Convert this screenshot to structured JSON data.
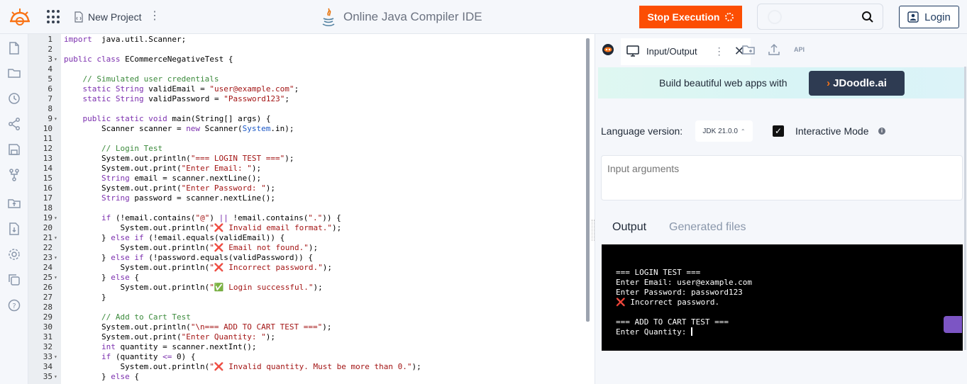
{
  "header": {
    "project_name": "New Project",
    "title": "Online Java Compiler IDE",
    "stop_label": "Stop Execution",
    "login_label": "Login"
  },
  "sidebar": {
    "icons": [
      "file-icon",
      "folder-icon",
      "history-icon",
      "share-icon",
      "save-icon",
      "fork-icon",
      "folder-upload-icon",
      "download-icon",
      "settings-icon",
      "copy-icon",
      "help-icon"
    ]
  },
  "editor": {
    "lines": [
      {
        "n": "1",
        "fold": "",
        "segs": [
          [
            "kw",
            "import"
          ],
          [
            "",
            "  java.util.Scanner;"
          ]
        ]
      },
      {
        "n": "2",
        "fold": "",
        "segs": []
      },
      {
        "n": "3",
        "fold": "▾",
        "segs": [
          [
            "kw",
            "public"
          ],
          [
            "",
            " "
          ],
          [
            "kw",
            "class"
          ],
          [
            "",
            " ECommerceNegativeTest {"
          ]
        ]
      },
      {
        "n": "4",
        "fold": "",
        "segs": []
      },
      {
        "n": "5",
        "fold": "",
        "segs": [
          [
            "",
            "    "
          ],
          [
            "cm",
            "// Simulated user credentials"
          ]
        ]
      },
      {
        "n": "6",
        "fold": "",
        "segs": [
          [
            "",
            "    "
          ],
          [
            "kw",
            "static"
          ],
          [
            "",
            " "
          ],
          [
            "ty",
            "String"
          ],
          [
            "",
            " validEmail = "
          ],
          [
            "str",
            "\"user@example.com\""
          ],
          [
            "",
            ";"
          ]
        ]
      },
      {
        "n": "7",
        "fold": "",
        "segs": [
          [
            "",
            "    "
          ],
          [
            "kw",
            "static"
          ],
          [
            "",
            " "
          ],
          [
            "ty",
            "String"
          ],
          [
            "",
            " validPassword = "
          ],
          [
            "str",
            "\"Password123\""
          ],
          [
            "",
            ";"
          ]
        ]
      },
      {
        "n": "8",
        "fold": "",
        "segs": []
      },
      {
        "n": "9",
        "fold": "▾",
        "segs": [
          [
            "",
            "    "
          ],
          [
            "kw",
            "public"
          ],
          [
            "",
            " "
          ],
          [
            "kw",
            "static"
          ],
          [
            "",
            " "
          ],
          [
            "kw",
            "void"
          ],
          [
            "",
            " main(String[] args) {"
          ]
        ]
      },
      {
        "n": "10",
        "fold": "",
        "segs": [
          [
            "",
            "        Scanner scanner = "
          ],
          [
            "kw",
            "new"
          ],
          [
            "",
            " Scanner("
          ],
          [
            "blue",
            "System"
          ],
          [
            "",
            ".in);"
          ]
        ]
      },
      {
        "n": "11",
        "fold": "",
        "segs": []
      },
      {
        "n": "12",
        "fold": "",
        "segs": [
          [
            "",
            "        "
          ],
          [
            "cm",
            "// Login Test"
          ]
        ]
      },
      {
        "n": "13",
        "fold": "",
        "segs": [
          [
            "",
            "        System.out.println("
          ],
          [
            "str",
            "\"=== LOGIN TEST ===\""
          ],
          [
            "",
            ");"
          ]
        ]
      },
      {
        "n": "14",
        "fold": "",
        "segs": [
          [
            "",
            "        System.out.print("
          ],
          [
            "str",
            "\"Enter Email: \""
          ],
          [
            "",
            ");"
          ]
        ]
      },
      {
        "n": "15",
        "fold": "",
        "segs": [
          [
            "",
            "        "
          ],
          [
            "ty",
            "String"
          ],
          [
            "",
            " email = scanner.nextLine();"
          ]
        ]
      },
      {
        "n": "16",
        "fold": "",
        "segs": [
          [
            "",
            "        System.out.print("
          ],
          [
            "str",
            "\"Enter Password: \""
          ],
          [
            "",
            ");"
          ]
        ]
      },
      {
        "n": "17",
        "fold": "",
        "segs": [
          [
            "",
            "        "
          ],
          [
            "ty",
            "String"
          ],
          [
            "",
            " password = scanner.nextLine();"
          ]
        ]
      },
      {
        "n": "18",
        "fold": "",
        "segs": []
      },
      {
        "n": "19",
        "fold": "▾",
        "segs": [
          [
            "",
            "        "
          ],
          [
            "kw",
            "if"
          ],
          [
            "",
            " (!email.contains("
          ],
          [
            "str",
            "\"@\""
          ],
          [
            "",
            ") "
          ],
          [
            "op",
            "||"
          ],
          [
            "",
            " !email.contains("
          ],
          [
            "str",
            "\".\""
          ],
          [
            "",
            ")) {"
          ]
        ]
      },
      {
        "n": "20",
        "fold": "",
        "segs": [
          [
            "",
            "            System.out.println("
          ],
          [
            "str",
            "\"❌ Invalid email format.\""
          ],
          [
            "",
            ");"
          ]
        ]
      },
      {
        "n": "21",
        "fold": "▾",
        "segs": [
          [
            "",
            "        } "
          ],
          [
            "kw",
            "else"
          ],
          [
            "",
            " "
          ],
          [
            "kw",
            "if"
          ],
          [
            "",
            " (!email.equals(validEmail)) {"
          ]
        ]
      },
      {
        "n": "22",
        "fold": "",
        "segs": [
          [
            "",
            "            System.out.println("
          ],
          [
            "str",
            "\"❌ Email not found.\""
          ],
          [
            "",
            ");"
          ]
        ]
      },
      {
        "n": "23",
        "fold": "▾",
        "segs": [
          [
            "",
            "        } "
          ],
          [
            "kw",
            "else"
          ],
          [
            "",
            " "
          ],
          [
            "kw",
            "if"
          ],
          [
            "",
            " (!password.equals(validPassword)) {"
          ]
        ]
      },
      {
        "n": "24",
        "fold": "",
        "segs": [
          [
            "",
            "            System.out.println("
          ],
          [
            "str",
            "\"❌ Incorrect password.\""
          ],
          [
            "",
            ");"
          ]
        ]
      },
      {
        "n": "25",
        "fold": "▾",
        "segs": [
          [
            "",
            "        } "
          ],
          [
            "kw",
            "else"
          ],
          [
            "",
            " {"
          ]
        ]
      },
      {
        "n": "26",
        "fold": "",
        "segs": [
          [
            "",
            "            System.out.println("
          ],
          [
            "str",
            "\"✅ Login successful.\""
          ],
          [
            "",
            ");"
          ]
        ]
      },
      {
        "n": "27",
        "fold": "",
        "segs": [
          [
            "",
            "        }"
          ]
        ]
      },
      {
        "n": "28",
        "fold": "",
        "segs": []
      },
      {
        "n": "29",
        "fold": "",
        "segs": [
          [
            "",
            "        "
          ],
          [
            "cm",
            "// Add to Cart Test"
          ]
        ]
      },
      {
        "n": "30",
        "fold": "",
        "segs": [
          [
            "",
            "        System.out.println("
          ],
          [
            "str",
            "\"\\n=== ADD TO CART TEST ===\""
          ],
          [
            "",
            ");"
          ]
        ]
      },
      {
        "n": "31",
        "fold": "",
        "segs": [
          [
            "",
            "        System.out.print("
          ],
          [
            "str",
            "\"Enter Quantity: \""
          ],
          [
            "",
            ");"
          ]
        ]
      },
      {
        "n": "32",
        "fold": "",
        "segs": [
          [
            "",
            "        "
          ],
          [
            "kw",
            "int"
          ],
          [
            "",
            " quantity = scanner.nextInt();"
          ]
        ]
      },
      {
        "n": "33",
        "fold": "▾",
        "segs": [
          [
            "",
            "        "
          ],
          [
            "kw",
            "if"
          ],
          [
            "",
            " (quantity "
          ],
          [
            "op",
            "<="
          ],
          [
            "",
            " 0) {"
          ]
        ]
      },
      {
        "n": "34",
        "fold": "",
        "segs": [
          [
            "",
            "            System.out.println("
          ],
          [
            "str",
            "\"❌ Invalid quantity. Must be more than 0.\""
          ],
          [
            "",
            ");"
          ]
        ]
      },
      {
        "n": "35",
        "fold": "▾",
        "segs": [
          [
            "",
            "        } "
          ],
          [
            "kw",
            "else"
          ],
          [
            "",
            " {"
          ]
        ]
      }
    ]
  },
  "right_panel": {
    "tab_label": "Input/Output",
    "api_label": "API",
    "banner_text": "Build beautiful web apps with",
    "banner_button": "JDoodle.ai",
    "language_label": "Language version:",
    "language_value": "JDK 21.0.0",
    "interactive_label": "Interactive Mode",
    "interactive_checked": true,
    "args_placeholder": "Input arguments",
    "output_tab": "Output",
    "files_tab": "Generated files",
    "console_lines": [
      {
        "text": "=== LOGIN TEST ===",
        "error": false
      },
      {
        "text": "Enter Email: user@example.com",
        "error": false
      },
      {
        "text": "Enter Password: password123",
        "error": false
      },
      {
        "text": "❌ Incorrect password.",
        "error": true
      },
      {
        "text": "",
        "error": false
      },
      {
        "text": "=== ADD TO CART TEST ===",
        "error": false
      },
      {
        "text": "Enter Quantity: ",
        "error": false,
        "cursor": true
      }
    ]
  },
  "colors": {
    "stop_button": "#fc4e03",
    "login_border": "#1e3a5f",
    "jdoodle_button": "#2e3b52",
    "console_bg": "#000000"
  }
}
